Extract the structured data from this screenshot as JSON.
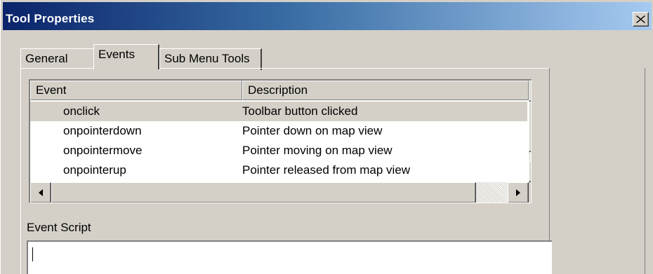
{
  "window": {
    "title": "Tool Properties"
  },
  "tabs": [
    {
      "label": "General",
      "active": false
    },
    {
      "label": "Events",
      "active": true
    },
    {
      "label": "Sub Menu Tools",
      "active": false
    }
  ],
  "events_list": {
    "columns": [
      "Event",
      "Description"
    ],
    "rows": [
      {
        "event": "onclick",
        "description": "Toolbar button clicked",
        "selected": true
      },
      {
        "event": "onpointerdown",
        "description": "Pointer down on map view",
        "selected": false
      },
      {
        "event": "onpointermove",
        "description": "Pointer moving on map view",
        "selected": false
      },
      {
        "event": "onpointerup",
        "description": "Pointer released from map view",
        "selected": false
      }
    ]
  },
  "event_script": {
    "label": "Event Script",
    "value": ""
  },
  "icons": {
    "close": "close-icon",
    "scroll_up": "arrow-up-icon",
    "scroll_down": "arrow-down-icon",
    "scroll_left": "arrow-left-icon",
    "scroll_right": "arrow-right-icon"
  },
  "colors": {
    "titlebar_start": "#0a246a",
    "titlebar_end": "#a6caf0",
    "face": "#d4d0c8"
  }
}
